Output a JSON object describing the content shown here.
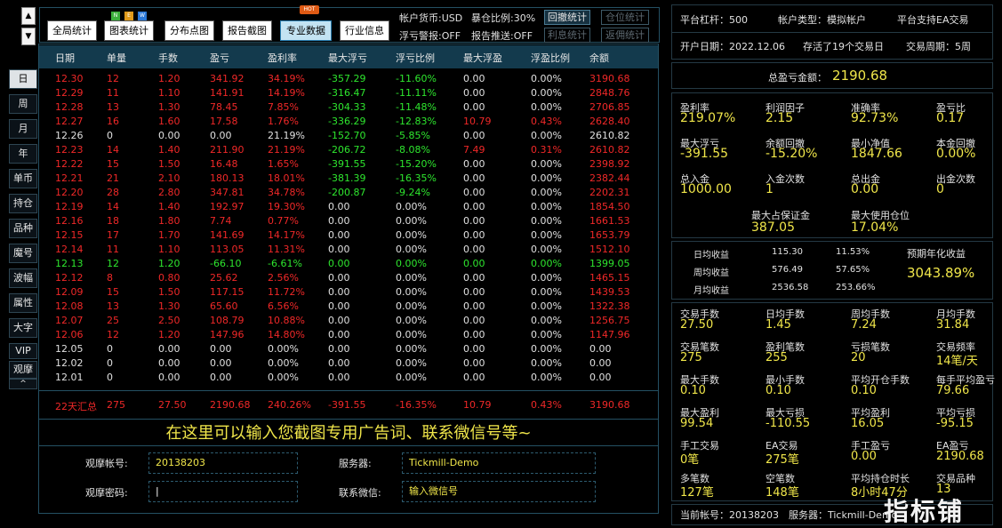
{
  "sidebar": {
    "up_arrow": "▲",
    "down_arrow": "▼",
    "items": [
      "日",
      "周",
      "月",
      "年",
      "单币",
      "持仓",
      "品种",
      "魔号",
      "波幅",
      "属性",
      "大字",
      "VIP",
      "观摩"
    ],
    "collapse": "^"
  },
  "toolbar": {
    "buttons": [
      "全局统计",
      "图表统计",
      "分布点图",
      "报告截图",
      "专业数据",
      "行业信息"
    ],
    "new_badge": [
      "N",
      "E",
      "W"
    ],
    "hot_badge": "HOT"
  },
  "account_info": {
    "currency": "帐户货币:USD",
    "margin_ratio": "暴仓比例:30%",
    "float_warning": "浮亏警报:OFF",
    "report_push": "报告推送:OFF"
  },
  "small_buttons": [
    "回撤统计",
    "仓位统计",
    "利息统计",
    "返佣统计"
  ],
  "table": {
    "headers": [
      "日期",
      "单量",
      "手数",
      "盈亏",
      "盈利率",
      "最大浮亏",
      "浮亏比例",
      "最大浮盈",
      "浮盈比例",
      "余额"
    ],
    "rows": [
      {
        "c": "red",
        "v": [
          "12.30",
          "12",
          "1.20",
          "341.92",
          "34.19%",
          "-357.29",
          "-11.60%",
          "0.00",
          "0.00%",
          "3190.68"
        ]
      },
      {
        "c": "red",
        "v": [
          "12.29",
          "11",
          "1.10",
          "141.91",
          "14.19%",
          "-316.47",
          "-11.11%",
          "0.00",
          "0.00%",
          "2848.76"
        ]
      },
      {
        "c": "red",
        "v": [
          "12.28",
          "13",
          "1.30",
          "78.45",
          "7.85%",
          "-304.33",
          "-11.48%",
          "0.00",
          "0.00%",
          "2706.85"
        ]
      },
      {
        "c": "red",
        "v": [
          "12.27",
          "16",
          "1.60",
          "17.58",
          "1.76%",
          "-336.29",
          "-12.83%",
          "10.79",
          "0.43%",
          "2628.40"
        ]
      },
      {
        "c": "white",
        "v": [
          "12.26",
          "0",
          "0.00",
          "0.00",
          "21.19%",
          "-152.70",
          "-5.85%",
          "0.00",
          "0.00%",
          "2610.82"
        ]
      },
      {
        "c": "red",
        "v": [
          "12.23",
          "14",
          "1.40",
          "211.90",
          "21.19%",
          "-206.72",
          "-8.08%",
          "7.49",
          "0.31%",
          "2610.82"
        ]
      },
      {
        "c": "red",
        "v": [
          "12.22",
          "15",
          "1.50",
          "16.48",
          "1.65%",
          "-391.55",
          "-15.20%",
          "0.00",
          "0.00%",
          "2398.92"
        ]
      },
      {
        "c": "red",
        "v": [
          "12.21",
          "21",
          "2.10",
          "180.13",
          "18.01%",
          "-381.39",
          "-16.35%",
          "0.00",
          "0.00%",
          "2382.44"
        ]
      },
      {
        "c": "red",
        "v": [
          "12.20",
          "28",
          "2.80",
          "347.81",
          "34.78%",
          "-200.87",
          "-9.24%",
          "0.00",
          "0.00%",
          "2202.31"
        ]
      },
      {
        "c": "red",
        "v": [
          "12.19",
          "14",
          "1.40",
          "192.97",
          "19.30%",
          "0.00",
          "0.00%",
          "0.00",
          "0.00%",
          "1854.50"
        ]
      },
      {
        "c": "red",
        "v": [
          "12.16",
          "18",
          "1.80",
          "7.74",
          "0.77%",
          "0.00",
          "0.00%",
          "0.00",
          "0.00%",
          "1661.53"
        ]
      },
      {
        "c": "red",
        "v": [
          "12.15",
          "17",
          "1.70",
          "141.69",
          "14.17%",
          "0.00",
          "0.00%",
          "0.00",
          "0.00%",
          "1653.79"
        ]
      },
      {
        "c": "red",
        "v": [
          "12.14",
          "11",
          "1.10",
          "113.05",
          "11.31%",
          "0.00",
          "0.00%",
          "0.00",
          "0.00%",
          "1512.10"
        ]
      },
      {
        "c": "green",
        "v": [
          "12.13",
          "12",
          "1.20",
          "-66.10",
          "-6.61%",
          "0.00",
          "0.00%",
          "0.00",
          "0.00%",
          "1399.05"
        ]
      },
      {
        "c": "red",
        "v": [
          "12.12",
          "8",
          "0.80",
          "25.62",
          "2.56%",
          "0.00",
          "0.00%",
          "0.00",
          "0.00%",
          "1465.15"
        ]
      },
      {
        "c": "red",
        "v": [
          "12.09",
          "15",
          "1.50",
          "117.15",
          "11.72%",
          "0.00",
          "0.00%",
          "0.00",
          "0.00%",
          "1439.53"
        ]
      },
      {
        "c": "red",
        "v": [
          "12.08",
          "13",
          "1.30",
          "65.60",
          "6.56%",
          "0.00",
          "0.00%",
          "0.00",
          "0.00%",
          "1322.38"
        ]
      },
      {
        "c": "red",
        "v": [
          "12.07",
          "25",
          "2.50",
          "108.79",
          "10.88%",
          "0.00",
          "0.00%",
          "0.00",
          "0.00%",
          "1256.75"
        ]
      },
      {
        "c": "red",
        "v": [
          "12.06",
          "12",
          "1.20",
          "147.96",
          "14.80%",
          "0.00",
          "0.00%",
          "0.00",
          "0.00%",
          "1147.96"
        ]
      },
      {
        "c": "white",
        "v": [
          "12.05",
          "0",
          "0.00",
          "0.00",
          "0.00%",
          "0.00",
          "0.00%",
          "0.00",
          "0.00%",
          "0.00"
        ]
      },
      {
        "c": "white",
        "v": [
          "12.02",
          "0",
          "0.00",
          "0.00",
          "0.00%",
          "0.00",
          "0.00%",
          "0.00",
          "0.00%",
          "0.00"
        ]
      },
      {
        "c": "white",
        "v": [
          "12.01",
          "0",
          "0.00",
          "0.00",
          "0.00%",
          "0.00",
          "0.00%",
          "0.00",
          "0.00%",
          "0.00"
        ]
      }
    ],
    "summary": [
      "22天汇总",
      "275",
      "27.50",
      "2190.68",
      "240.26%",
      "-391.55",
      "-16.35%",
      "10.79",
      "0.43%",
      "3190.68"
    ]
  },
  "ad_text": "在这里可以输入您截图专用广告词、联系微信号等~",
  "form": {
    "account_label": "观摩帐号:",
    "account_value": "20138203",
    "password_label": "观摩密码:",
    "password_value": "",
    "server_label": "服务器:",
    "server_value": "Tickmill-Demo",
    "wechat_label": "联系微信:",
    "wechat_value": "输入微信号"
  },
  "right": {
    "leverage": "平台杠杆：500",
    "account_type": "帐户类型：模拟帐户",
    "ea_support": "平台支持EA交易",
    "open_date": "开户日期：2022.12.06",
    "days_alive": "存活了19个交易日",
    "week_cycle": "交易周期：5周",
    "total_pl_label": "总盈亏金额：",
    "total_pl_value": "2190.68",
    "grid1": [
      {
        "l": "盈利率",
        "v": "219.07%"
      },
      {
        "l": "利润因子",
        "v": "2.15"
      },
      {
        "l": "准确率",
        "v": "92.73%"
      },
      {
        "l": "盈亏比",
        "v": "0.17"
      },
      {
        "l": "最大浮亏",
        "v": "-391.55"
      },
      {
        "l": "余额回撤",
        "v": "-15.20%"
      },
      {
        "l": "最小净值",
        "v": "1847.66"
      },
      {
        "l": "本金回撤",
        "v": "0.00%"
      },
      {
        "l": "总入金",
        "v": "1000.00"
      },
      {
        "l": "入金次数",
        "v": "1"
      },
      {
        "l": "总出金",
        "v": "0.00"
      },
      {
        "l": "出金次数",
        "v": "0"
      }
    ],
    "max_margin_label": "最大占保证金",
    "max_margin_value": "387.05",
    "max_position_label": "最大使用仓位",
    "max_position_value": "17.04%",
    "returns": [
      {
        "l": "日均收益",
        "a": "115.30",
        "p": "11.53%"
      },
      {
        "l": "周均收益",
        "a": "576.49",
        "p": "57.65%"
      },
      {
        "l": "月均收益",
        "a": "2536.58",
        "p": "253.66%"
      }
    ],
    "annual_label": "预期年化收益",
    "annual_value": "3043.89%",
    "grid2": [
      {
        "l": "交易手数",
        "v": "27.50"
      },
      {
        "l": "日均手数",
        "v": "1.45"
      },
      {
        "l": "周均手数",
        "v": "7.24"
      },
      {
        "l": "月均手数",
        "v": "31.84"
      },
      {
        "l": "交易笔数",
        "v": "275"
      },
      {
        "l": "盈利笔数",
        "v": "255"
      },
      {
        "l": "亏损笔数",
        "v": "20"
      },
      {
        "l": "交易频率",
        "v": "14笔/天"
      },
      {
        "l": "最大手数",
        "v": "0.10"
      },
      {
        "l": "最小手数",
        "v": "0.10"
      },
      {
        "l": "平均开仓手数",
        "v": "0.10"
      },
      {
        "l": "每手平均盈亏",
        "v": "79.66"
      },
      {
        "l": "最大盈利",
        "v": "99.54"
      },
      {
        "l": "最大亏损",
        "v": "-110.55"
      },
      {
        "l": "平均盈利",
        "v": "16.05"
      },
      {
        "l": "平均亏损",
        "v": "-95.15"
      },
      {
        "l": "手工交易",
        "v": "0笔"
      },
      {
        "l": "EA交易",
        "v": "275笔"
      },
      {
        "l": "手工盈亏",
        "v": "0.00"
      },
      {
        "l": "EA盈亏",
        "v": "2190.68"
      },
      {
        "l": "多笔数",
        "v": "127笔"
      },
      {
        "l": "空笔数",
        "v": "148笔"
      },
      {
        "l": "平均持仓时长",
        "v": "8小时47分"
      },
      {
        "l": "交易品种",
        "v": "13"
      }
    ],
    "footer_account": "当前帐号：20138203",
    "footer_server": "服务器：Tickmill-Demo"
  },
  "watermark": "指标铺",
  "colors": {
    "red": "#f02828",
    "green": "#2ee62e",
    "white": "#e0e0e0",
    "yellow": "#f0e64a",
    "header": "#133a4d"
  }
}
